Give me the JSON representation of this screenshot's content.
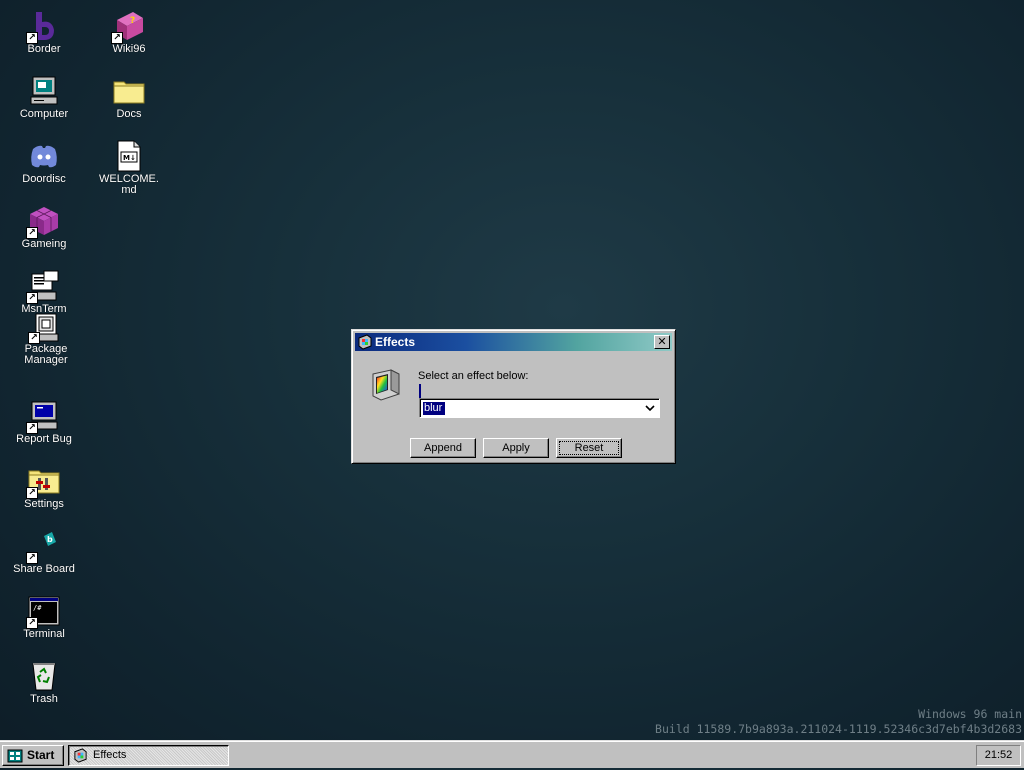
{
  "desktop": {
    "icons": [
      {
        "label": "Border",
        "icon": "border-app-icon"
      },
      {
        "label": "Wiki96",
        "icon": "wiki-book-icon"
      },
      {
        "label": "Computer",
        "icon": "computer-icon"
      },
      {
        "label": "Docs",
        "icon": "folder-icon"
      },
      {
        "label": "Doordisc",
        "icon": "discord-icon"
      },
      {
        "label": "WELCOME.md",
        "icon": "markdown-file-icon"
      },
      {
        "label": "Gameing",
        "icon": "game-cube-icon"
      },
      {
        "label": "MsnTerm",
        "icon": "msn-terminal-icon"
      },
      {
        "label": "Package Manager",
        "icon": "package-manager-icon"
      },
      {
        "label": "Report Bug",
        "icon": "report-bug-icon"
      },
      {
        "label": "Settings",
        "icon": "settings-folder-icon"
      },
      {
        "label": "Share Board",
        "icon": "share-board-icon"
      },
      {
        "label": "Terminal",
        "icon": "terminal-icon"
      },
      {
        "label": "Trash",
        "icon": "recycle-bin-icon"
      }
    ],
    "watermark": {
      "line1": "Windows 96 main",
      "line2": "Build 11589.7b9a893a.211024-1119.52346c3d7ebf4b3d2683"
    }
  },
  "dialog": {
    "title": "Effects",
    "close_label": "✕",
    "prompt": "Select an effect below:",
    "selected_effect": "blur",
    "buttons": {
      "append": "Append",
      "apply": "Apply",
      "reset": "Reset"
    }
  },
  "taskbar": {
    "start_label": "Start",
    "tasks": [
      {
        "label": "Effects"
      }
    ],
    "clock": "21:52"
  },
  "colors": {
    "desktop_bg": "#17303b",
    "titlebar_start": "#0b2a7e",
    "titlebar_end": "#8fc9c6",
    "face": "#c0c0c0",
    "selection": "#000080"
  }
}
